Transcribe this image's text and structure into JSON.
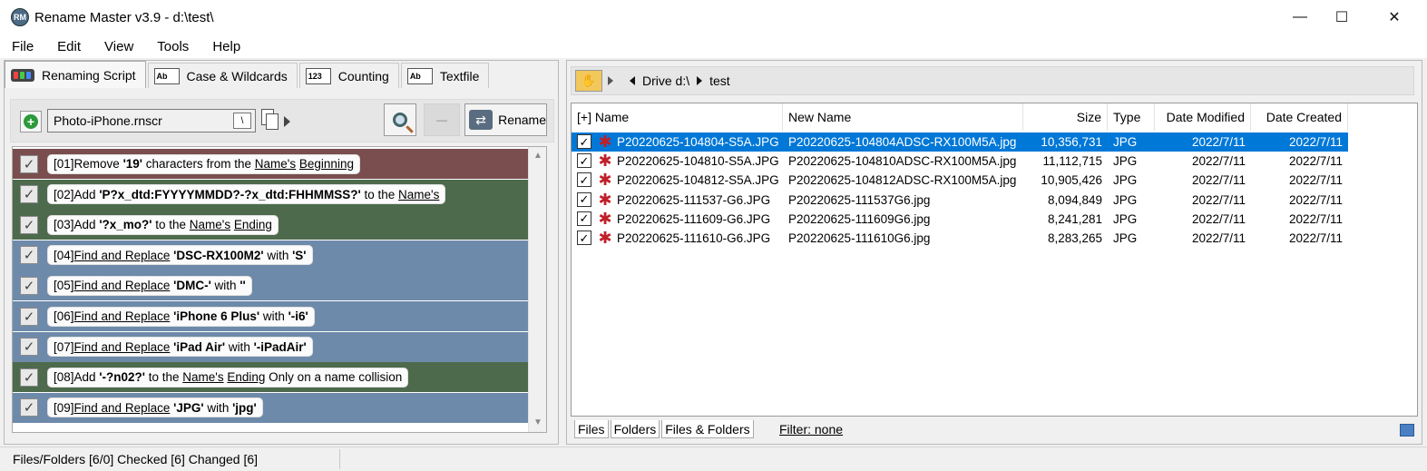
{
  "window": {
    "title": "Rename Master v3.9 - d:\\test\\",
    "app_icon_text": "RM",
    "minimize": "—",
    "maximize": "☐",
    "close": "✕"
  },
  "menu": [
    "File",
    "Edit",
    "View",
    "Tools",
    "Help"
  ],
  "tabs": [
    {
      "label": "Renaming Script",
      "icon": "script-icon",
      "active": true
    },
    {
      "label": "Case & Wildcards",
      "icon": "Ab",
      "active": false
    },
    {
      "label": "Counting",
      "icon": "123",
      "active": false
    },
    {
      "label": "Textfile",
      "icon": "Ab",
      "active": false
    }
  ],
  "toolbar": {
    "script_file": "Photo-iPhone.rnscr",
    "rename_label": "Rename"
  },
  "rules": [
    {
      "id": "[01]",
      "color": "#7a4e4e",
      "checked": true,
      "parts": [
        [
          "t",
          "Remove "
        ],
        [
          "b",
          "'19'"
        ],
        [
          "t",
          " characters from the "
        ],
        [
          "u",
          "Name's"
        ],
        [
          "t",
          " "
        ],
        [
          "u",
          "Beginning"
        ]
      ]
    },
    {
      "id": "[02]",
      "color": "#4d6a4d",
      "checked": true,
      "parts": [
        [
          "t",
          "Add "
        ],
        [
          "b",
          "'P?x_dtd:FYYYYMMDD?-?x_dtd:FHHMMSS?'"
        ],
        [
          "t",
          " to the "
        ],
        [
          "u",
          "Name's"
        ]
      ]
    },
    {
      "id": "[03]",
      "color": "#4d6a4d",
      "checked": true,
      "parts": [
        [
          "t",
          "Add "
        ],
        [
          "b",
          "'?x_mo?'"
        ],
        [
          "t",
          " to the "
        ],
        [
          "u",
          "Name's"
        ],
        [
          "t",
          " "
        ],
        [
          "u",
          "Ending"
        ]
      ]
    },
    {
      "id": "[04]",
      "color": "#6e8aaa",
      "checked": true,
      "parts": [
        [
          "u",
          "Find and Replace"
        ],
        [
          "t",
          " "
        ],
        [
          "b",
          "'DSC-RX100M2'"
        ],
        [
          "t",
          " with "
        ],
        [
          "b",
          "'S'"
        ]
      ]
    },
    {
      "id": "[05]",
      "color": "#6e8aaa",
      "checked": true,
      "parts": [
        [
          "u",
          "Find and Replace"
        ],
        [
          "t",
          " "
        ],
        [
          "b",
          "'DMC-'"
        ],
        [
          "t",
          " with "
        ],
        [
          "b",
          "''"
        ]
      ]
    },
    {
      "id": "[06]",
      "color": "#6e8aaa",
      "checked": true,
      "parts": [
        [
          "u",
          "Find and Replace"
        ],
        [
          "t",
          " "
        ],
        [
          "b",
          "'iPhone 6 Plus'"
        ],
        [
          "t",
          " with "
        ],
        [
          "b",
          "'-i6'"
        ]
      ]
    },
    {
      "id": "[07]",
      "color": "#6e8aaa",
      "checked": true,
      "parts": [
        [
          "u",
          "Find and Replace"
        ],
        [
          "t",
          " "
        ],
        [
          "b",
          "'iPad Air'"
        ],
        [
          "t",
          " with "
        ],
        [
          "b",
          "'-iPadAir'"
        ]
      ]
    },
    {
      "id": "[08]",
      "color": "#4d6a4d",
      "checked": true,
      "parts": [
        [
          "t",
          "Add "
        ],
        [
          "b",
          "'-?n02?'"
        ],
        [
          "t",
          " to the "
        ],
        [
          "u",
          "Name's"
        ],
        [
          "t",
          " "
        ],
        [
          "u",
          "Ending"
        ],
        [
          "t",
          " Only on a name collision"
        ]
      ]
    },
    {
      "id": "[09]",
      "color": "#6e8aaa",
      "checked": true,
      "parts": [
        [
          "u",
          "Find and Replace"
        ],
        [
          "t",
          " "
        ],
        [
          "b",
          "'JPG'"
        ],
        [
          "t",
          " with "
        ],
        [
          "b",
          "'jpg'"
        ]
      ]
    }
  ],
  "breadcrumb": {
    "drive": "Drive d:\\",
    "folder": "test"
  },
  "file_columns": [
    "[+] Name",
    "New Name",
    "Size",
    "Type",
    "Date Modified",
    "Date Created"
  ],
  "files": [
    {
      "name": "P20220625-104804-S5A.JPG",
      "new_name": "P20220625-104804ADSC-RX100M5A.jpg",
      "size": "10,356,731",
      "type": "JPG",
      "modified": "2022/7/11",
      "created": "2022/7/11",
      "selected": true
    },
    {
      "name": "P20220625-104810-S5A.JPG",
      "new_name": "P20220625-104810ADSC-RX100M5A.jpg",
      "size": "11,112,715",
      "type": "JPG",
      "modified": "2022/7/11",
      "created": "2022/7/11",
      "selected": false
    },
    {
      "name": "P20220625-104812-S5A.JPG",
      "new_name": "P20220625-104812ADSC-RX100M5A.jpg",
      "size": "10,905,426",
      "type": "JPG",
      "modified": "2022/7/11",
      "created": "2022/7/11",
      "selected": false
    },
    {
      "name": "P20220625-111537-G6.JPG",
      "new_name": "P20220625-111537G6.jpg",
      "size": "8,094,849",
      "type": "JPG",
      "modified": "2022/7/11",
      "created": "2022/7/11",
      "selected": false
    },
    {
      "name": "P20220625-111609-G6.JPG",
      "new_name": "P20220625-111609G6.jpg",
      "size": "8,241,281",
      "type": "JPG",
      "modified": "2022/7/11",
      "created": "2022/7/11",
      "selected": false
    },
    {
      "name": "P20220625-111610-G6.JPG",
      "new_name": "P20220625-111610G6.jpg",
      "size": "8,283,265",
      "type": "JPG",
      "modified": "2022/7/11",
      "created": "2022/7/11",
      "selected": false
    }
  ],
  "bottom_tabs": [
    "Files",
    "Folders",
    "Files & Folders"
  ],
  "filter": "Filter:  none",
  "status": "Files/Folders [6/0] Checked [6] Changed [6]",
  "colors": {
    "selection": "#0078d7",
    "remove_rule": "#7a4e4e",
    "add_rule": "#4d6a4d",
    "replace_rule": "#6e8aaa"
  }
}
